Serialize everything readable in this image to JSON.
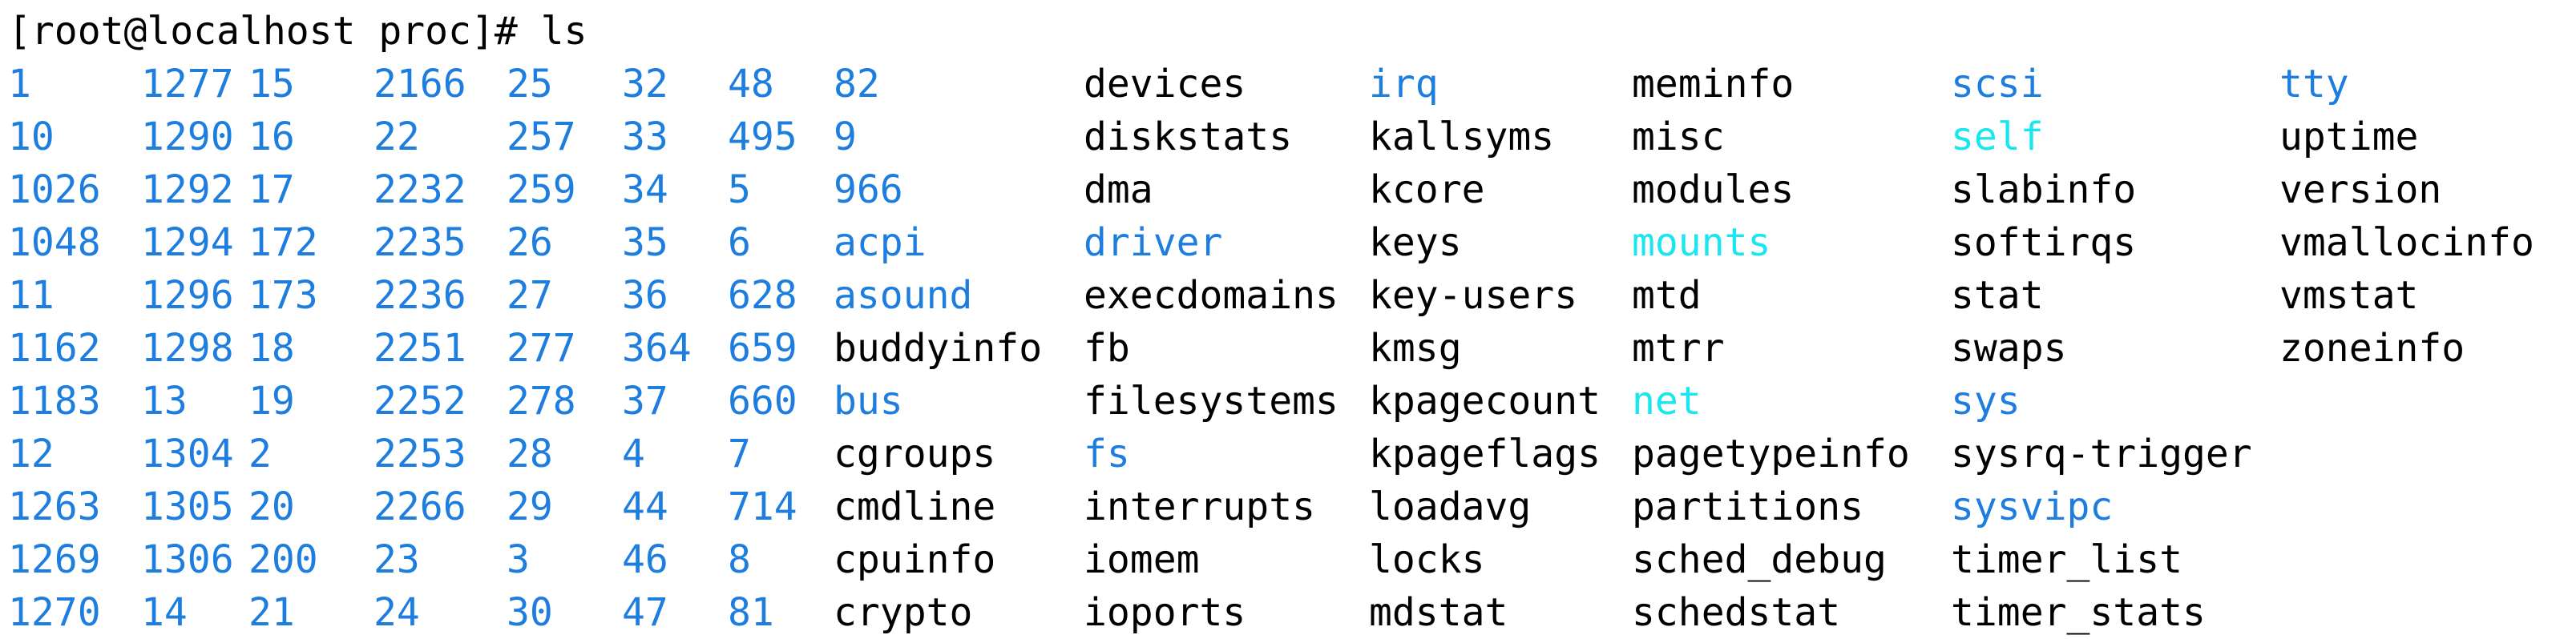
{
  "prompt": "[root@localhost proc]# ls",
  "colors": {
    "directory": "#1e7ee0",
    "symlink": "#19e6f0",
    "file": "#000000",
    "background": "#ffffff"
  },
  "columns": [
    [
      {
        "name": "1",
        "type": "dir"
      },
      {
        "name": "10",
        "type": "dir"
      },
      {
        "name": "1026",
        "type": "dir"
      },
      {
        "name": "1048",
        "type": "dir"
      },
      {
        "name": "11",
        "type": "dir"
      },
      {
        "name": "1162",
        "type": "dir"
      },
      {
        "name": "1183",
        "type": "dir"
      },
      {
        "name": "12",
        "type": "dir"
      },
      {
        "name": "1263",
        "type": "dir"
      },
      {
        "name": "1269",
        "type": "dir"
      },
      {
        "name": "1270",
        "type": "dir"
      }
    ],
    [
      {
        "name": "1277",
        "type": "dir"
      },
      {
        "name": "1290",
        "type": "dir"
      },
      {
        "name": "1292",
        "type": "dir"
      },
      {
        "name": "1294",
        "type": "dir"
      },
      {
        "name": "1296",
        "type": "dir"
      },
      {
        "name": "1298",
        "type": "dir"
      },
      {
        "name": "13",
        "type": "dir"
      },
      {
        "name": "1304",
        "type": "dir"
      },
      {
        "name": "1305",
        "type": "dir"
      },
      {
        "name": "1306",
        "type": "dir"
      },
      {
        "name": "14",
        "type": "dir"
      }
    ],
    [
      {
        "name": "15",
        "type": "dir"
      },
      {
        "name": "16",
        "type": "dir"
      },
      {
        "name": "17",
        "type": "dir"
      },
      {
        "name": "172",
        "type": "dir"
      },
      {
        "name": "173",
        "type": "dir"
      },
      {
        "name": "18",
        "type": "dir"
      },
      {
        "name": "19",
        "type": "dir"
      },
      {
        "name": "2",
        "type": "dir"
      },
      {
        "name": "20",
        "type": "dir"
      },
      {
        "name": "200",
        "type": "dir"
      },
      {
        "name": "21",
        "type": "dir"
      }
    ],
    [
      {
        "name": "2166",
        "type": "dir"
      },
      {
        "name": "22",
        "type": "dir"
      },
      {
        "name": "2232",
        "type": "dir"
      },
      {
        "name": "2235",
        "type": "dir"
      },
      {
        "name": "2236",
        "type": "dir"
      },
      {
        "name": "2251",
        "type": "dir"
      },
      {
        "name": "2252",
        "type": "dir"
      },
      {
        "name": "2253",
        "type": "dir"
      },
      {
        "name": "2266",
        "type": "dir"
      },
      {
        "name": "23",
        "type": "dir"
      },
      {
        "name": "24",
        "type": "dir"
      }
    ],
    [
      {
        "name": "25",
        "type": "dir"
      },
      {
        "name": "257",
        "type": "dir"
      },
      {
        "name": "259",
        "type": "dir"
      },
      {
        "name": "26",
        "type": "dir"
      },
      {
        "name": "27",
        "type": "dir"
      },
      {
        "name": "277",
        "type": "dir"
      },
      {
        "name": "278",
        "type": "dir"
      },
      {
        "name": "28",
        "type": "dir"
      },
      {
        "name": "29",
        "type": "dir"
      },
      {
        "name": "3",
        "type": "dir"
      },
      {
        "name": "30",
        "type": "dir"
      }
    ],
    [
      {
        "name": "32",
        "type": "dir"
      },
      {
        "name": "33",
        "type": "dir"
      },
      {
        "name": "34",
        "type": "dir"
      },
      {
        "name": "35",
        "type": "dir"
      },
      {
        "name": "36",
        "type": "dir"
      },
      {
        "name": "364",
        "type": "dir"
      },
      {
        "name": "37",
        "type": "dir"
      },
      {
        "name": "4",
        "type": "dir"
      },
      {
        "name": "44",
        "type": "dir"
      },
      {
        "name": "46",
        "type": "dir"
      },
      {
        "name": "47",
        "type": "dir"
      }
    ],
    [
      {
        "name": "48",
        "type": "dir"
      },
      {
        "name": "495",
        "type": "dir"
      },
      {
        "name": "5",
        "type": "dir"
      },
      {
        "name": "6",
        "type": "dir"
      },
      {
        "name": "628",
        "type": "dir"
      },
      {
        "name": "659",
        "type": "dir"
      },
      {
        "name": "660",
        "type": "dir"
      },
      {
        "name": "7",
        "type": "dir"
      },
      {
        "name": "714",
        "type": "dir"
      },
      {
        "name": "8",
        "type": "dir"
      },
      {
        "name": "81",
        "type": "dir"
      }
    ],
    [
      {
        "name": "82",
        "type": "dir"
      },
      {
        "name": "9",
        "type": "dir"
      },
      {
        "name": "966",
        "type": "dir"
      },
      {
        "name": "acpi",
        "type": "dir"
      },
      {
        "name": "asound",
        "type": "dir"
      },
      {
        "name": "buddyinfo",
        "type": "file"
      },
      {
        "name": "bus",
        "type": "dir"
      },
      {
        "name": "cgroups",
        "type": "file"
      },
      {
        "name": "cmdline",
        "type": "file"
      },
      {
        "name": "cpuinfo",
        "type": "file"
      },
      {
        "name": "crypto",
        "type": "file"
      }
    ],
    [
      {
        "name": "devices",
        "type": "file"
      },
      {
        "name": "diskstats",
        "type": "file"
      },
      {
        "name": "dma",
        "type": "file"
      },
      {
        "name": "driver",
        "type": "dir"
      },
      {
        "name": "execdomains",
        "type": "file"
      },
      {
        "name": "fb",
        "type": "file"
      },
      {
        "name": "filesystems",
        "type": "file"
      },
      {
        "name": "fs",
        "type": "dir"
      },
      {
        "name": "interrupts",
        "type": "file"
      },
      {
        "name": "iomem",
        "type": "file"
      },
      {
        "name": "ioports",
        "type": "file"
      }
    ],
    [
      {
        "name": "irq",
        "type": "dir"
      },
      {
        "name": "kallsyms",
        "type": "file"
      },
      {
        "name": "kcore",
        "type": "file"
      },
      {
        "name": "keys",
        "type": "file"
      },
      {
        "name": "key-users",
        "type": "file"
      },
      {
        "name": "kmsg",
        "type": "file"
      },
      {
        "name": "kpagecount",
        "type": "file"
      },
      {
        "name": "kpageflags",
        "type": "file"
      },
      {
        "name": "loadavg",
        "type": "file"
      },
      {
        "name": "locks",
        "type": "file"
      },
      {
        "name": "mdstat",
        "type": "file"
      }
    ],
    [
      {
        "name": "meminfo",
        "type": "file"
      },
      {
        "name": "misc",
        "type": "file"
      },
      {
        "name": "modules",
        "type": "file"
      },
      {
        "name": "mounts",
        "type": "link"
      },
      {
        "name": "mtd",
        "type": "file"
      },
      {
        "name": "mtrr",
        "type": "file"
      },
      {
        "name": "net",
        "type": "link"
      },
      {
        "name": "pagetypeinfo",
        "type": "file"
      },
      {
        "name": "partitions",
        "type": "file"
      },
      {
        "name": "sched_debug",
        "type": "file"
      },
      {
        "name": "schedstat",
        "type": "file"
      }
    ],
    [
      {
        "name": "scsi",
        "type": "dir"
      },
      {
        "name": "self",
        "type": "link"
      },
      {
        "name": "slabinfo",
        "type": "file"
      },
      {
        "name": "softirqs",
        "type": "file"
      },
      {
        "name": "stat",
        "type": "file"
      },
      {
        "name": "swaps",
        "type": "file"
      },
      {
        "name": "sys",
        "type": "dir"
      },
      {
        "name": "sysrq-trigger",
        "type": "file"
      },
      {
        "name": "sysvipc",
        "type": "dir"
      },
      {
        "name": "timer_list",
        "type": "file"
      },
      {
        "name": "timer_stats",
        "type": "file"
      }
    ],
    [
      {
        "name": "tty",
        "type": "dir"
      },
      {
        "name": "uptime",
        "type": "file"
      },
      {
        "name": "version",
        "type": "file"
      },
      {
        "name": "vmallocinfo",
        "type": "file"
      },
      {
        "name": "vmstat",
        "type": "file"
      },
      {
        "name": "zoneinfo",
        "type": "file"
      }
    ]
  ]
}
